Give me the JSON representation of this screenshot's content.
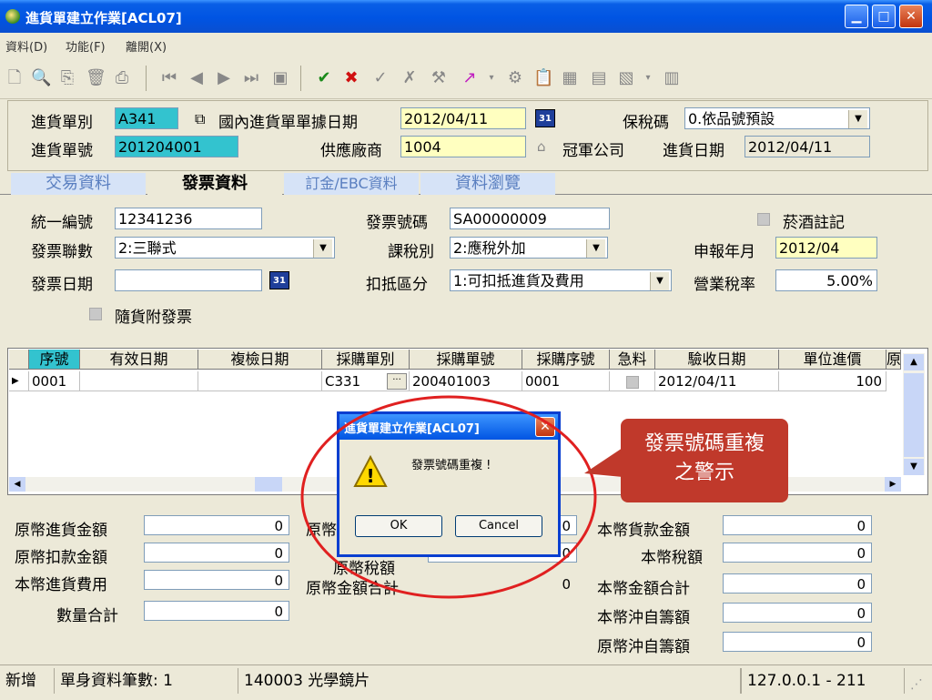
{
  "window": {
    "title": "進貨單建立作業[ACL07]"
  },
  "menu": [
    "資料(D)",
    "功能(F)",
    "離開(X)"
  ],
  "header": {
    "type_label": "進貨單別",
    "type_value": "A341",
    "domestic_label": "國內進貨單單據日期",
    "doc_date": "2012/04/11",
    "bonded_label": "保稅碼",
    "bonded_value": "0.依品號預設",
    "no_label": "進貨單號",
    "no_value": "201204001",
    "vendor_label": "供應廠商",
    "vendor_code": "1004",
    "vendor_name": "冠軍公司",
    "recv_date_label": "進貨日期",
    "recv_date": "2012/04/11"
  },
  "tabs": [
    "交易資料",
    "發票資料",
    "訂金/EBC資料",
    "資料瀏覽"
  ],
  "invoice": {
    "uniform_label": "統一編號",
    "uniform_value": "12341236",
    "invno_label": "發票號碼",
    "invno_value": "SA00000009",
    "tobacco_label": "菸酒註記",
    "copies_label": "發票聯數",
    "copies_value": "2:三聯式",
    "taxtype_label": "課稅別",
    "taxtype_value": "2:應稅外加",
    "report_label": "申報年月",
    "report_value": "2012/04",
    "invdate_label": "發票日期",
    "invdate_value": "",
    "deduct_label": "扣抵區分",
    "deduct_value": "1:可扣抵進貨及費用",
    "taxrate_label": "營業稅率",
    "taxrate_value": "5.00%",
    "attached_label": "隨貨附發票"
  },
  "grid": {
    "headers": [
      "序號",
      "有效日期",
      "複檢日期",
      "採購單別",
      "採購單號",
      "採購序號",
      "急料",
      "驗收日期",
      "單位進價",
      "原"
    ],
    "row": [
      "0001",
      "",
      "",
      "C331",
      "200401003",
      "0001",
      "",
      "2012/04/11",
      "100"
    ]
  },
  "totals": {
    "left": [
      {
        "label": "原幣進貨金額",
        "value": "0"
      },
      {
        "label": "原幣扣款金額",
        "value": "0"
      },
      {
        "label": "本幣進貨費用",
        "value": "0"
      },
      {
        "label": "數量合計",
        "value": "0"
      }
    ],
    "mid": [
      {
        "label": "原幣",
        "value": "0"
      },
      {
        "label": "原幣稅額",
        "value": "0"
      },
      {
        "label": "原幣金額合計",
        "value": "0"
      }
    ],
    "right": [
      {
        "label": "本幣貨款金額",
        "value": "0"
      },
      {
        "label": "本幣稅額",
        "value": "0"
      },
      {
        "label": "本幣金額合計",
        "value": "0"
      },
      {
        "label": "本幣沖自籌額",
        "value": "0"
      },
      {
        "label": "原幣沖自籌額",
        "value": "0"
      }
    ]
  },
  "status": {
    "mode": "新增",
    "count_label": "單身資料筆數: 1",
    "product": "140003 光學鏡片",
    "host": "127.0.0.1 - 211"
  },
  "dialog": {
    "title": "進貨單建立作業[ACL07]",
    "message": "發票號碼重複 !",
    "ok": "OK",
    "cancel": "Cancel"
  },
  "callout": {
    "line1": "發票號碼重複",
    "line2": "之警示"
  },
  "colors": {
    "accent": "#0054e3",
    "callout": "#c0392b",
    "highlight": "#ffffc0",
    "ellipse": "#e02020"
  }
}
